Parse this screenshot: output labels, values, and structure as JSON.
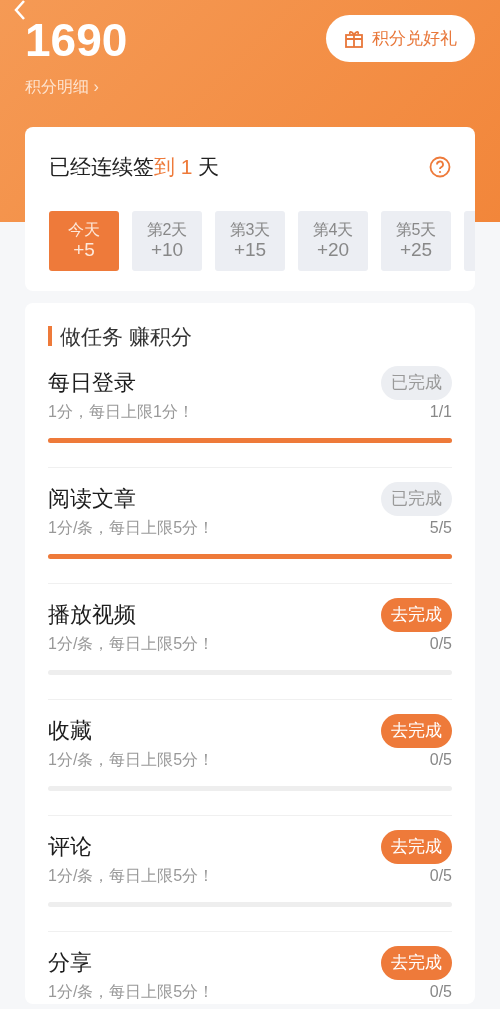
{
  "header": {
    "points": "1690",
    "details_link": "积分明细 ›",
    "redeem_button": "积分兑好礼"
  },
  "checkin": {
    "streak_prefix": "已经连续签",
    "streak_highlight": "到 1",
    "streak_suffix": "天",
    "days": [
      {
        "label": "今天",
        "bonus": "+5",
        "selected": true
      },
      {
        "label": "第2天",
        "bonus": "+10",
        "selected": false
      },
      {
        "label": "第3天",
        "bonus": "+15",
        "selected": false
      },
      {
        "label": "第4天",
        "bonus": "+20",
        "selected": false
      },
      {
        "label": "第5天",
        "bonus": "+25",
        "selected": false
      }
    ]
  },
  "tasks_section": {
    "title": "做任务 赚积分",
    "tasks": [
      {
        "title": "每日登录",
        "description": "1分，每日上限1分！",
        "progress": "1/1",
        "level": 1,
        "status": {
          "kind": "done",
          "label": "已完成"
        }
      },
      {
        "title": "阅读文章",
        "description": "1分/条，每日上限5分！",
        "progress": "5/5",
        "level": 1,
        "status": {
          "kind": "done",
          "label": "已完成"
        }
      },
      {
        "title": "播放视频",
        "description": "1分/条，每日上限5分！",
        "progress": "0/5",
        "status": {
          "kind": "todo",
          "label": "去完成"
        }
      },
      {
        "title": "收藏",
        "description": "1分/条，每日上限5分！",
        "progress": "0/5",
        "status": {
          "kind": "todo",
          "label": "去完成"
        }
      },
      {
        "title": "评论",
        "description": "1分/条，每日上限5分！",
        "progress": "0/5",
        "status": {
          "kind": "todo",
          "label": "去完成"
        }
      },
      {
        "title": "分享",
        "description": "1分/条，每日上限5分！",
        "progress": "0/5",
        "status": {
          "kind": "todo",
          "label": "去完成"
        }
      }
    ]
  }
}
